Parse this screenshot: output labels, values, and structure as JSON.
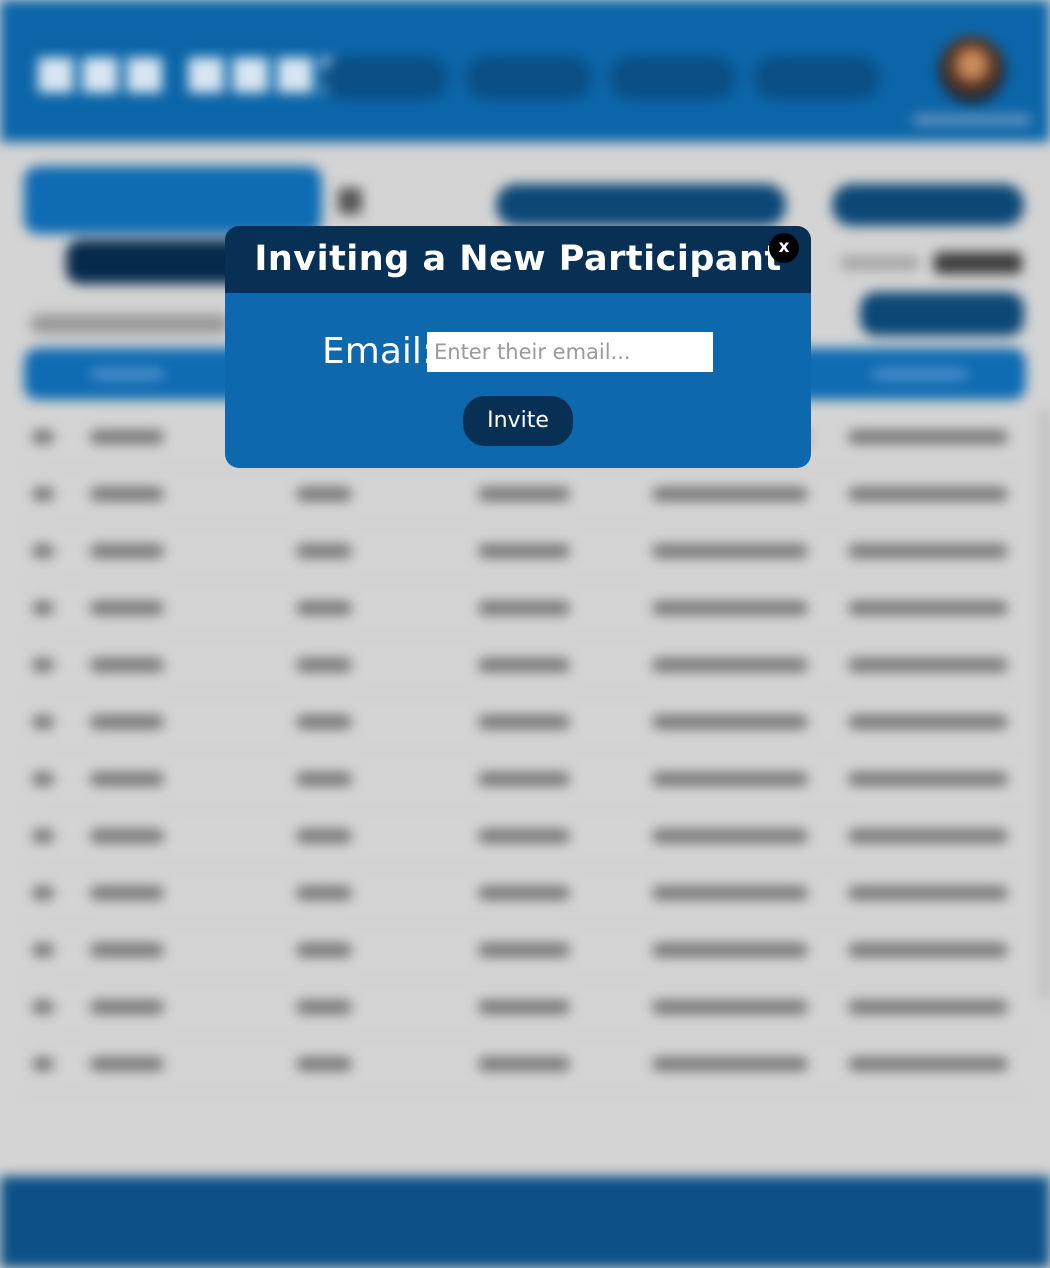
{
  "modal": {
    "title": "Inviting a New Participant",
    "close_label": "x",
    "email_label": "Email:",
    "email_placeholder": "Enter their email...",
    "email_value": "",
    "invite_label": "Invite"
  },
  "colors": {
    "header_blue": "#0b65a8",
    "modal_blue": "#0e68ad",
    "modal_dark": "#083055",
    "page_gray": "#d4d4d4"
  },
  "background": {
    "blurred": true,
    "table_row_count": 12
  }
}
